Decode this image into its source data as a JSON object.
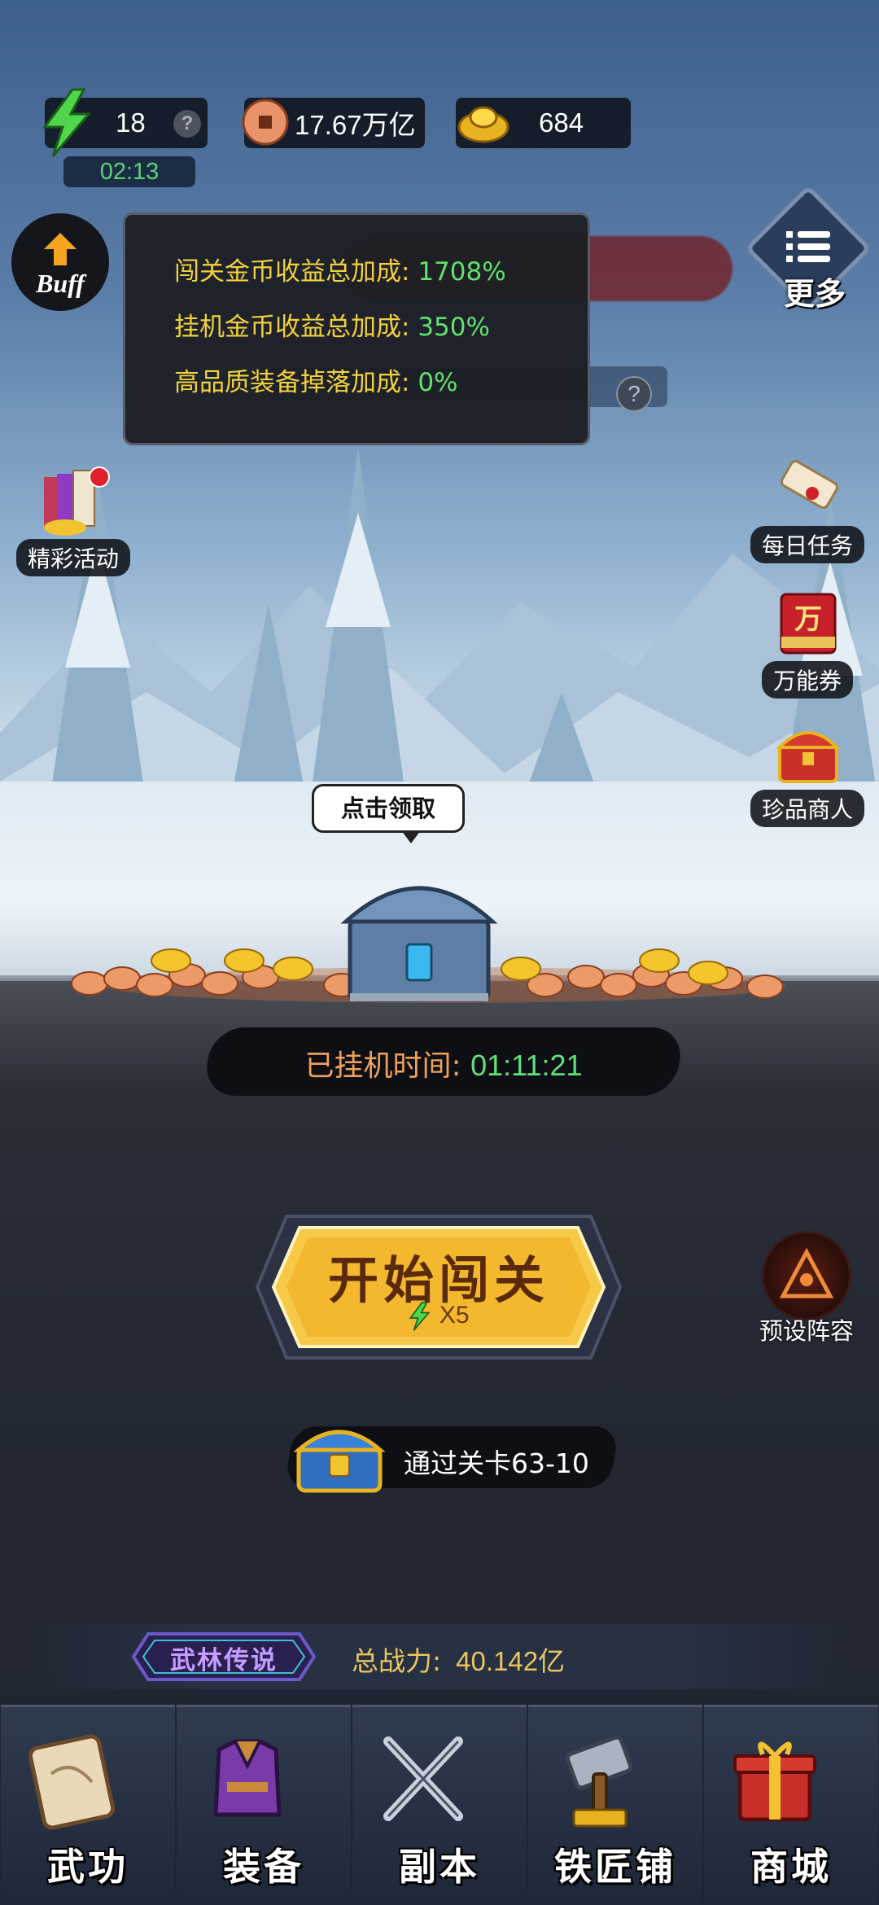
{
  "resources": {
    "energy": "18",
    "coins": "17.67万亿",
    "gold": "684",
    "energy_timer": "02:13"
  },
  "side_left": {
    "buff_label": "Buff",
    "event_label": "精彩活动"
  },
  "side_right": {
    "more_label": "更多",
    "daily_task_label": "每日任务",
    "voucher_label": "万能券",
    "voucher_glyph": "万",
    "treasure_shop_label": "珍品商人",
    "lineup_label": "预设阵容"
  },
  "tooltip": {
    "rows": [
      {
        "label": "闯关金币收益总加成:",
        "value": "1708%"
      },
      {
        "label": "挂机金币收益总加成:",
        "value": "350%"
      },
      {
        "label": "高品质装备掉落加成:",
        "value": "0%"
      }
    ]
  },
  "chest": {
    "bubble": "点击领取"
  },
  "idle": {
    "label": "已挂机时间:",
    "time": "01:11:21"
  },
  "start": {
    "label": "开始闯关",
    "cost": "X5"
  },
  "reward": {
    "text": "通过关卡63-10"
  },
  "power": {
    "rank": "武林传说",
    "label": "总战力:",
    "value": "40.142亿"
  },
  "nav": [
    {
      "label": "武功",
      "icon": "scroll-icon"
    },
    {
      "label": "装备",
      "icon": "armor-icon"
    },
    {
      "label": "副本",
      "icon": "crossed-swords-icon"
    },
    {
      "label": "铁匠铺",
      "icon": "hammer-icon"
    },
    {
      "label": "商城",
      "icon": "gift-box-icon"
    }
  ],
  "colors": {
    "tooltip_label": "#f2d13d",
    "tooltip_value": "#5fe36b",
    "timer_green": "#5ed17a",
    "start_button": "#f7c948"
  }
}
